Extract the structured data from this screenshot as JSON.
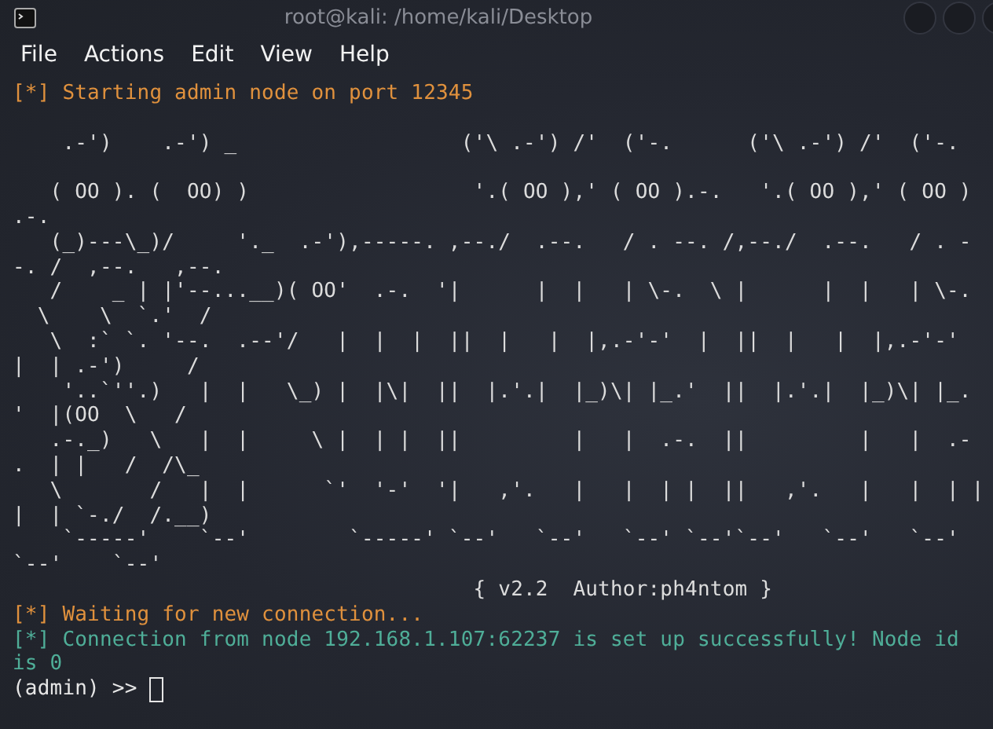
{
  "window": {
    "title": "root@kali: /home/kali/Desktop"
  },
  "menu": [
    "File",
    "Actions",
    "Edit",
    "View",
    "Help"
  ],
  "terminal": {
    "lines": [
      {
        "kind": "info",
        "text": "[*] Starting admin node on port 12345"
      },
      {
        "kind": "spacer"
      },
      {
        "kind": "banner",
        "text": "    .-')    .-') _                  ('\\ .-') /'  ('-.      ('\\ .-') /'  ('-."
      },
      {
        "kind": "spacer"
      },
      {
        "kind": "banner",
        "text": "   ( OO ). (  OO) )                  '.( OO ),' ( OO ).-.   '.( OO ),' ( OO )"
      },
      {
        "kind": "banner",
        "text": ".-."
      },
      {
        "kind": "banner",
        "text": "   (_)---\\_)/     '._  .-'),-----. ,--./  .--.   / . --. /,--./  .--.   / . -"
      },
      {
        "kind": "banner",
        "text": "-. /  ,--.   ,--."
      },
      {
        "kind": "banner",
        "text": "   /    _ | |'--...__)( OO'  .-.  '|      |  |   | \\-.  \\ |      |  |   | \\-."
      },
      {
        "kind": "banner",
        "text": "  \\    \\  `.'  /"
      },
      {
        "kind": "banner",
        "text": "   \\  :` `. '--.  .--'/   |  |  |  ||  |   |  |,.-'-'  |  ||  |   |  |,.-'-'"
      },
      {
        "kind": "banner",
        "text": "|  | .-')     /"
      },
      {
        "kind": "banner",
        "text": "    '..`''.)   |  |   \\_) |  |\\|  ||  |.'.|  |_)\\| |_.'  ||  |.'.|  |_)\\| |_."
      },
      {
        "kind": "banner",
        "text": "'  |(OO  \\   /"
      },
      {
        "kind": "banner",
        "text": "   .-._)   \\   |  |     \\ |  | |  ||         |   |  .-.  ||         |   |  .-"
      },
      {
        "kind": "banner",
        "text": ".  | |   /  /\\_"
      },
      {
        "kind": "banner",
        "text": "   \\       /   |  |      `'  '-'  '|   ,'.   |   |  | |  ||   ,'.   |   |  | |"
      },
      {
        "kind": "banner",
        "text": "|  | `-./  /.__)"
      },
      {
        "kind": "banner",
        "text": "    `-----'    `--'        `-----' `--'   `--'   `--' `--'`--'   `--'   `--'"
      },
      {
        "kind": "banner",
        "text": "`--'    `--'"
      },
      {
        "kind": "banner",
        "text": "                                     { v2.2  Author:ph4ntom }"
      },
      {
        "kind": "info",
        "text": "[*] Waiting for new connection..."
      },
      {
        "kind": "success",
        "text": "[*] Connection from node 192.168.1.107:62237 is set up successfully! Node id is 0"
      },
      {
        "kind": "prompt",
        "text": "(admin) >>"
      }
    ]
  }
}
